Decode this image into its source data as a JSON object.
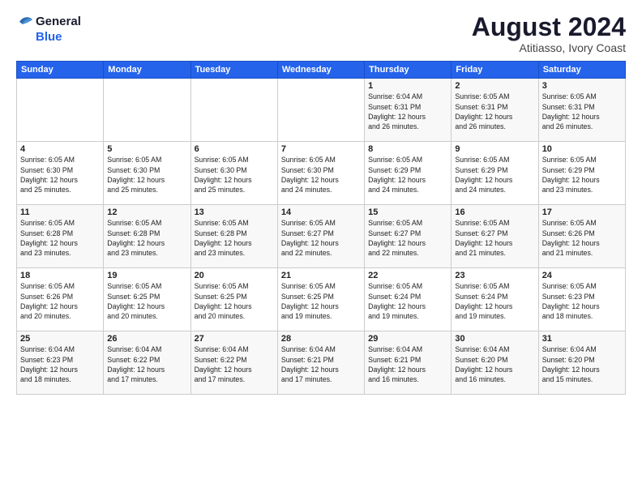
{
  "header": {
    "logo_line1": "General",
    "logo_line2": "Blue",
    "month": "August 2024",
    "location": "Atitiasso, Ivory Coast"
  },
  "weekdays": [
    "Sunday",
    "Monday",
    "Tuesday",
    "Wednesday",
    "Thursday",
    "Friday",
    "Saturday"
  ],
  "weeks": [
    [
      {
        "day": "",
        "info": ""
      },
      {
        "day": "",
        "info": ""
      },
      {
        "day": "",
        "info": ""
      },
      {
        "day": "",
        "info": ""
      },
      {
        "day": "1",
        "info": "Sunrise: 6:04 AM\nSunset: 6:31 PM\nDaylight: 12 hours\nand 26 minutes."
      },
      {
        "day": "2",
        "info": "Sunrise: 6:05 AM\nSunset: 6:31 PM\nDaylight: 12 hours\nand 26 minutes."
      },
      {
        "day": "3",
        "info": "Sunrise: 6:05 AM\nSunset: 6:31 PM\nDaylight: 12 hours\nand 26 minutes."
      }
    ],
    [
      {
        "day": "4",
        "info": "Sunrise: 6:05 AM\nSunset: 6:30 PM\nDaylight: 12 hours\nand 25 minutes."
      },
      {
        "day": "5",
        "info": "Sunrise: 6:05 AM\nSunset: 6:30 PM\nDaylight: 12 hours\nand 25 minutes."
      },
      {
        "day": "6",
        "info": "Sunrise: 6:05 AM\nSunset: 6:30 PM\nDaylight: 12 hours\nand 25 minutes."
      },
      {
        "day": "7",
        "info": "Sunrise: 6:05 AM\nSunset: 6:30 PM\nDaylight: 12 hours\nand 24 minutes."
      },
      {
        "day": "8",
        "info": "Sunrise: 6:05 AM\nSunset: 6:29 PM\nDaylight: 12 hours\nand 24 minutes."
      },
      {
        "day": "9",
        "info": "Sunrise: 6:05 AM\nSunset: 6:29 PM\nDaylight: 12 hours\nand 24 minutes."
      },
      {
        "day": "10",
        "info": "Sunrise: 6:05 AM\nSunset: 6:29 PM\nDaylight: 12 hours\nand 23 minutes."
      }
    ],
    [
      {
        "day": "11",
        "info": "Sunrise: 6:05 AM\nSunset: 6:28 PM\nDaylight: 12 hours\nand 23 minutes."
      },
      {
        "day": "12",
        "info": "Sunrise: 6:05 AM\nSunset: 6:28 PM\nDaylight: 12 hours\nand 23 minutes."
      },
      {
        "day": "13",
        "info": "Sunrise: 6:05 AM\nSunset: 6:28 PM\nDaylight: 12 hours\nand 23 minutes."
      },
      {
        "day": "14",
        "info": "Sunrise: 6:05 AM\nSunset: 6:27 PM\nDaylight: 12 hours\nand 22 minutes."
      },
      {
        "day": "15",
        "info": "Sunrise: 6:05 AM\nSunset: 6:27 PM\nDaylight: 12 hours\nand 22 minutes."
      },
      {
        "day": "16",
        "info": "Sunrise: 6:05 AM\nSunset: 6:27 PM\nDaylight: 12 hours\nand 21 minutes."
      },
      {
        "day": "17",
        "info": "Sunrise: 6:05 AM\nSunset: 6:26 PM\nDaylight: 12 hours\nand 21 minutes."
      }
    ],
    [
      {
        "day": "18",
        "info": "Sunrise: 6:05 AM\nSunset: 6:26 PM\nDaylight: 12 hours\nand 20 minutes."
      },
      {
        "day": "19",
        "info": "Sunrise: 6:05 AM\nSunset: 6:25 PM\nDaylight: 12 hours\nand 20 minutes."
      },
      {
        "day": "20",
        "info": "Sunrise: 6:05 AM\nSunset: 6:25 PM\nDaylight: 12 hours\nand 20 minutes."
      },
      {
        "day": "21",
        "info": "Sunrise: 6:05 AM\nSunset: 6:25 PM\nDaylight: 12 hours\nand 19 minutes."
      },
      {
        "day": "22",
        "info": "Sunrise: 6:05 AM\nSunset: 6:24 PM\nDaylight: 12 hours\nand 19 minutes."
      },
      {
        "day": "23",
        "info": "Sunrise: 6:05 AM\nSunset: 6:24 PM\nDaylight: 12 hours\nand 19 minutes."
      },
      {
        "day": "24",
        "info": "Sunrise: 6:05 AM\nSunset: 6:23 PM\nDaylight: 12 hours\nand 18 minutes."
      }
    ],
    [
      {
        "day": "25",
        "info": "Sunrise: 6:04 AM\nSunset: 6:23 PM\nDaylight: 12 hours\nand 18 minutes."
      },
      {
        "day": "26",
        "info": "Sunrise: 6:04 AM\nSunset: 6:22 PM\nDaylight: 12 hours\nand 17 minutes."
      },
      {
        "day": "27",
        "info": "Sunrise: 6:04 AM\nSunset: 6:22 PM\nDaylight: 12 hours\nand 17 minutes."
      },
      {
        "day": "28",
        "info": "Sunrise: 6:04 AM\nSunset: 6:21 PM\nDaylight: 12 hours\nand 17 minutes."
      },
      {
        "day": "29",
        "info": "Sunrise: 6:04 AM\nSunset: 6:21 PM\nDaylight: 12 hours\nand 16 minutes."
      },
      {
        "day": "30",
        "info": "Sunrise: 6:04 AM\nSunset: 6:20 PM\nDaylight: 12 hours\nand 16 minutes."
      },
      {
        "day": "31",
        "info": "Sunrise: 6:04 AM\nSunset: 6:20 PM\nDaylight: 12 hours\nand 15 minutes."
      }
    ]
  ]
}
